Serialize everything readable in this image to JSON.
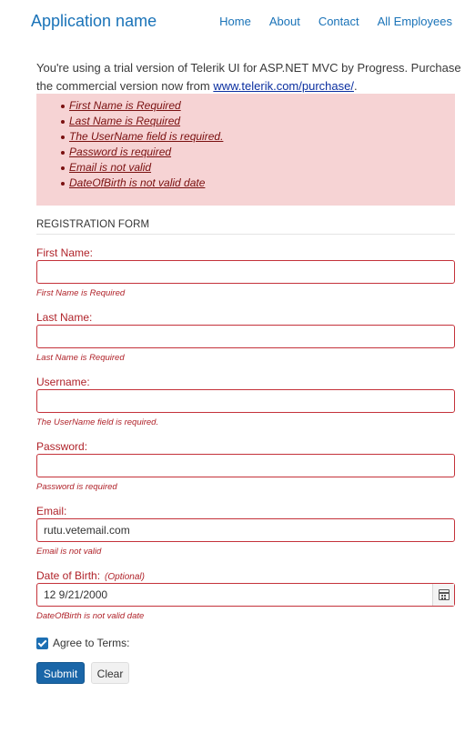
{
  "navbar": {
    "brand": "Application name",
    "links": [
      "Home",
      "About",
      "Contact",
      "All Employees"
    ]
  },
  "trial": {
    "text": "You're using a trial version of Telerik UI for ASP.NET MVC by Progress. Purchase the commercial version now from ",
    "link": "www.telerik.com/purchase/",
    "suffix": "."
  },
  "validation_summary": [
    "First Name is Required",
    "Last Name is Required",
    "The UserName field is required.",
    "Password is required",
    "Email is not valid",
    "DateOfBirth is not valid date"
  ],
  "form": {
    "legend": "REGISTRATION FORM",
    "first_name": {
      "label": "First Name:",
      "value": "",
      "error": "First Name is Required"
    },
    "last_name": {
      "label": "Last Name:",
      "value": "",
      "error": "Last Name is Required"
    },
    "username": {
      "label": "Username:",
      "value": "",
      "error": "The UserName field is required."
    },
    "password": {
      "label": "Password:",
      "value": "",
      "error": "Password is required"
    },
    "email": {
      "label": "Email:",
      "value": "rutu.vetemail.com",
      "error": "Email is not valid"
    },
    "dob": {
      "label": "Date of Birth:",
      "optional": "(Optional)",
      "value": "12 9/21/2000",
      "error": "DateOfBirth is not valid date"
    },
    "agree": {
      "label": "Agree to Terms:",
      "checked": true
    },
    "submit_label": "Submit",
    "clear_label": "Clear"
  },
  "colors": {
    "accent": "#1a73b8",
    "error": "#b0232a",
    "summary_bg": "#f6d3d4"
  }
}
